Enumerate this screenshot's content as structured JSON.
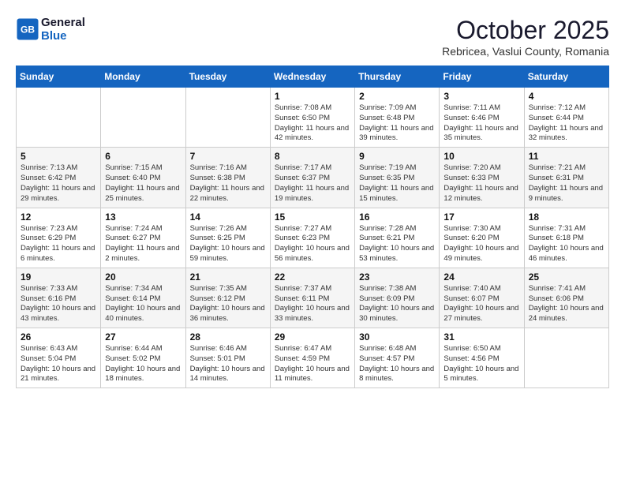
{
  "header": {
    "logo_line1": "General",
    "logo_line2": "Blue",
    "month": "October 2025",
    "location": "Rebricea, Vaslui County, Romania"
  },
  "days_of_week": [
    "Sunday",
    "Monday",
    "Tuesday",
    "Wednesday",
    "Thursday",
    "Friday",
    "Saturday"
  ],
  "weeks": [
    [
      {
        "day": "",
        "info": ""
      },
      {
        "day": "",
        "info": ""
      },
      {
        "day": "",
        "info": ""
      },
      {
        "day": "1",
        "info": "Sunrise: 7:08 AM\nSunset: 6:50 PM\nDaylight: 11 hours and 42 minutes."
      },
      {
        "day": "2",
        "info": "Sunrise: 7:09 AM\nSunset: 6:48 PM\nDaylight: 11 hours and 39 minutes."
      },
      {
        "day": "3",
        "info": "Sunrise: 7:11 AM\nSunset: 6:46 PM\nDaylight: 11 hours and 35 minutes."
      },
      {
        "day": "4",
        "info": "Sunrise: 7:12 AM\nSunset: 6:44 PM\nDaylight: 11 hours and 32 minutes."
      }
    ],
    [
      {
        "day": "5",
        "info": "Sunrise: 7:13 AM\nSunset: 6:42 PM\nDaylight: 11 hours and 29 minutes."
      },
      {
        "day": "6",
        "info": "Sunrise: 7:15 AM\nSunset: 6:40 PM\nDaylight: 11 hours and 25 minutes."
      },
      {
        "day": "7",
        "info": "Sunrise: 7:16 AM\nSunset: 6:38 PM\nDaylight: 11 hours and 22 minutes."
      },
      {
        "day": "8",
        "info": "Sunrise: 7:17 AM\nSunset: 6:37 PM\nDaylight: 11 hours and 19 minutes."
      },
      {
        "day": "9",
        "info": "Sunrise: 7:19 AM\nSunset: 6:35 PM\nDaylight: 11 hours and 15 minutes."
      },
      {
        "day": "10",
        "info": "Sunrise: 7:20 AM\nSunset: 6:33 PM\nDaylight: 11 hours and 12 minutes."
      },
      {
        "day": "11",
        "info": "Sunrise: 7:21 AM\nSunset: 6:31 PM\nDaylight: 11 hours and 9 minutes."
      }
    ],
    [
      {
        "day": "12",
        "info": "Sunrise: 7:23 AM\nSunset: 6:29 PM\nDaylight: 11 hours and 6 minutes."
      },
      {
        "day": "13",
        "info": "Sunrise: 7:24 AM\nSunset: 6:27 PM\nDaylight: 11 hours and 2 minutes."
      },
      {
        "day": "14",
        "info": "Sunrise: 7:26 AM\nSunset: 6:25 PM\nDaylight: 10 hours and 59 minutes."
      },
      {
        "day": "15",
        "info": "Sunrise: 7:27 AM\nSunset: 6:23 PM\nDaylight: 10 hours and 56 minutes."
      },
      {
        "day": "16",
        "info": "Sunrise: 7:28 AM\nSunset: 6:21 PM\nDaylight: 10 hours and 53 minutes."
      },
      {
        "day": "17",
        "info": "Sunrise: 7:30 AM\nSunset: 6:20 PM\nDaylight: 10 hours and 49 minutes."
      },
      {
        "day": "18",
        "info": "Sunrise: 7:31 AM\nSunset: 6:18 PM\nDaylight: 10 hours and 46 minutes."
      }
    ],
    [
      {
        "day": "19",
        "info": "Sunrise: 7:33 AM\nSunset: 6:16 PM\nDaylight: 10 hours and 43 minutes."
      },
      {
        "day": "20",
        "info": "Sunrise: 7:34 AM\nSunset: 6:14 PM\nDaylight: 10 hours and 40 minutes."
      },
      {
        "day": "21",
        "info": "Sunrise: 7:35 AM\nSunset: 6:12 PM\nDaylight: 10 hours and 36 minutes."
      },
      {
        "day": "22",
        "info": "Sunrise: 7:37 AM\nSunset: 6:11 PM\nDaylight: 10 hours and 33 minutes."
      },
      {
        "day": "23",
        "info": "Sunrise: 7:38 AM\nSunset: 6:09 PM\nDaylight: 10 hours and 30 minutes."
      },
      {
        "day": "24",
        "info": "Sunrise: 7:40 AM\nSunset: 6:07 PM\nDaylight: 10 hours and 27 minutes."
      },
      {
        "day": "25",
        "info": "Sunrise: 7:41 AM\nSunset: 6:06 PM\nDaylight: 10 hours and 24 minutes."
      }
    ],
    [
      {
        "day": "26",
        "info": "Sunrise: 6:43 AM\nSunset: 5:04 PM\nDaylight: 10 hours and 21 minutes."
      },
      {
        "day": "27",
        "info": "Sunrise: 6:44 AM\nSunset: 5:02 PM\nDaylight: 10 hours and 18 minutes."
      },
      {
        "day": "28",
        "info": "Sunrise: 6:46 AM\nSunset: 5:01 PM\nDaylight: 10 hours and 14 minutes."
      },
      {
        "day": "29",
        "info": "Sunrise: 6:47 AM\nSunset: 4:59 PM\nDaylight: 10 hours and 11 minutes."
      },
      {
        "day": "30",
        "info": "Sunrise: 6:48 AM\nSunset: 4:57 PM\nDaylight: 10 hours and 8 minutes."
      },
      {
        "day": "31",
        "info": "Sunrise: 6:50 AM\nSunset: 4:56 PM\nDaylight: 10 hours and 5 minutes."
      },
      {
        "day": "",
        "info": ""
      }
    ]
  ]
}
